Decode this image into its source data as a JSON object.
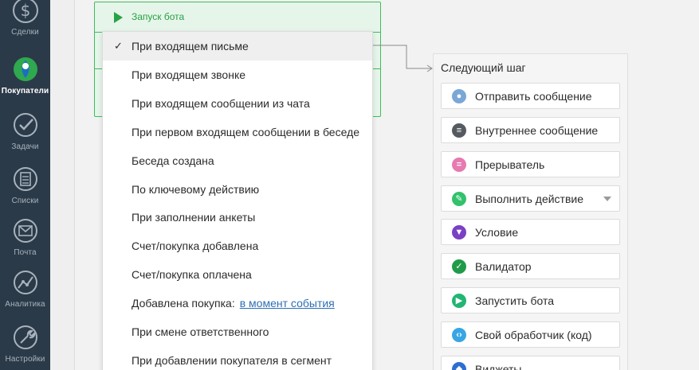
{
  "sidebar": {
    "items": [
      {
        "label": "Сделки",
        "icon": "dollar-icon",
        "active": false
      },
      {
        "label": "Покупатели",
        "icon": "customers-icon",
        "active": true
      },
      {
        "label": "Задачи",
        "icon": "check-circle-icon",
        "active": false
      },
      {
        "label": "Списки",
        "icon": "list-icon",
        "active": false
      },
      {
        "label": "Почта",
        "icon": "mail-icon",
        "active": false
      },
      {
        "label": "Аналитика",
        "icon": "analytics-icon",
        "active": false
      },
      {
        "label": "Настройки",
        "icon": "wrench-icon",
        "active": false
      }
    ]
  },
  "trigger": {
    "title": "Запуск бота"
  },
  "dropdown": {
    "items": [
      {
        "label": "При входящем письме",
        "selected": true
      },
      {
        "label": "При входящем звонке"
      },
      {
        "label": "При входящем сообщении из чата"
      },
      {
        "label": "При первом входящем сообщении в беседе"
      },
      {
        "label": "Беседа создана"
      },
      {
        "label": "По ключевому действию"
      },
      {
        "label": "При заполнении анкеты"
      },
      {
        "label": "Счет/покупка добавлена"
      },
      {
        "label": "Счет/покупка оплачена"
      },
      {
        "label": "Добавлена покупка:",
        "link": "в момент события"
      },
      {
        "label": "При смене ответственного"
      },
      {
        "label": "При добавлении покупателя в сегмент"
      }
    ],
    "check_glyph": "✓"
  },
  "next_step": {
    "title": "Следующий шаг",
    "steps": [
      {
        "label": "Отправить сообщение",
        "icon": "message-icon",
        "color": "#7aa7d6"
      },
      {
        "label": "Внутреннее сообщение",
        "icon": "chat-icon",
        "color": "#555a60"
      },
      {
        "label": "Прерыватель",
        "icon": "interrupt-icon",
        "color": "#e67ab1"
      },
      {
        "label": "Выполнить действие",
        "icon": "pencil-icon",
        "color": "#33c16c",
        "dropdown": true
      },
      {
        "label": "Условие",
        "icon": "filter-icon",
        "color": "#7b3fc4"
      },
      {
        "label": "Валидатор",
        "icon": "checkmark-icon",
        "color": "#1f9b4a"
      },
      {
        "label": "Запустить бота",
        "icon": "play-icon",
        "color": "#22b573"
      },
      {
        "label": "Свой обработчик (код)",
        "icon": "code-icon",
        "color": "#39a6e4"
      },
      {
        "label": "Виджеты",
        "icon": "widget-icon",
        "color": "#2d6fd1"
      }
    ]
  },
  "colors": {
    "sidebar_bg": "#2b3a48",
    "trigger_green": "#27a244",
    "link_blue": "#2d6fb5"
  }
}
